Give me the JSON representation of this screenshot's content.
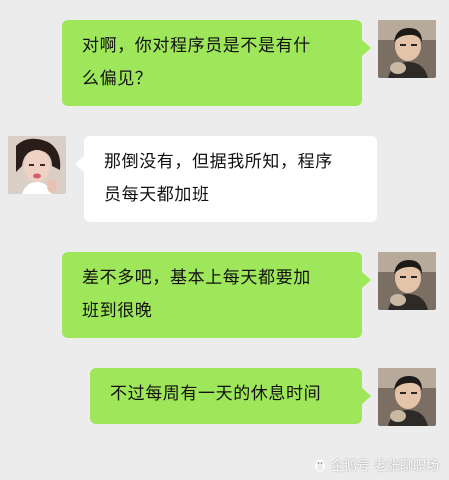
{
  "messages": [
    {
      "side": "sent",
      "lines": [
        "对啊，你对程序员是不是有什",
        "么偏见？"
      ],
      "avatar": "male-avatar"
    },
    {
      "side": "received",
      "lines": [
        "那倒没有，但据我所知，程序",
        "员每天都加班"
      ],
      "avatar": "female-avatar"
    },
    {
      "side": "sent",
      "lines": [
        "差不多吧，基本上每天都要加",
        "班到很晚"
      ],
      "avatar": "male-avatar"
    },
    {
      "side": "sent",
      "lines": [
        "不过每周有一天的休息时间"
      ],
      "avatar": "male-avatar"
    }
  ],
  "watermark": {
    "icon": "penguin-icon",
    "text": "企鹅号 老张聊职场"
  },
  "colors": {
    "background": "#ececec",
    "sent_bubble": "#9ee65a",
    "received_bubble": "#ffffff"
  }
}
